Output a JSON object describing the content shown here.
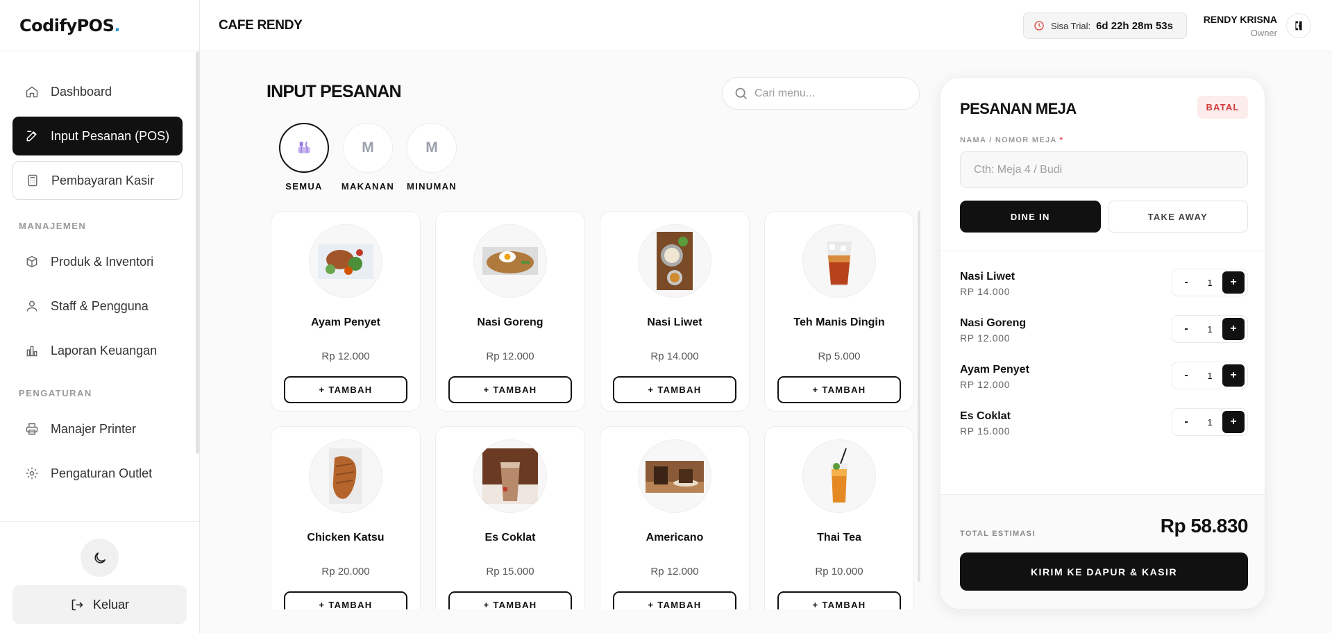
{
  "app": {
    "logo_text": "CodifyPOS",
    "logo_dot": "."
  },
  "sidebar": {
    "main_items": [
      {
        "label": "Dashboard",
        "icon": "home-icon"
      },
      {
        "label": "Input Pesanan (POS)",
        "icon": "edit-icon",
        "active": true
      },
      {
        "label": "Pembayaran Kasir",
        "icon": "calculator-icon"
      }
    ],
    "section_management": "MANAJEMEN",
    "management_items": [
      {
        "label": "Produk & Inventori",
        "icon": "box-icon"
      },
      {
        "label": "Staff & Pengguna",
        "icon": "users-icon"
      },
      {
        "label": "Laporan Keuangan",
        "icon": "bar-chart-icon"
      }
    ],
    "section_settings": "PENGATURAN",
    "settings_items": [
      {
        "label": "Manajer Printer",
        "icon": "printer-icon"
      },
      {
        "label": "Pengaturan Outlet",
        "icon": "gear-icon"
      }
    ],
    "logout_label": "Keluar"
  },
  "header": {
    "store_name": "CAFE RENDY",
    "trial_label": "Sisa Trial:",
    "trial_value": "6d 22h 28m 53s",
    "user_name": "RENDY KRISNA",
    "user_role": "Owner"
  },
  "main": {
    "title": "INPUT PESANAN",
    "search_placeholder": "Cari menu...",
    "categories": [
      {
        "label": "SEMUA",
        "initial": "",
        "active": true
      },
      {
        "label": "MAKANAN",
        "initial": "M"
      },
      {
        "label": "MINUMAN",
        "initial": "M"
      }
    ],
    "add_label": "+ TAMBAH",
    "products": [
      {
        "name": "Ayam Penyet",
        "price": "Rp 12.000",
        "image": "ayam-penyet"
      },
      {
        "name": "Nasi Goreng",
        "price": "Rp 12.000",
        "image": "nasi-goreng"
      },
      {
        "name": "Nasi Liwet",
        "price": "Rp 14.000",
        "image": "nasi-liwet"
      },
      {
        "name": "Teh Manis Dingin",
        "price": "Rp 5.000",
        "image": "teh-manis"
      },
      {
        "name": "Chicken Katsu",
        "price": "Rp 20.000",
        "image": "chicken-katsu"
      },
      {
        "name": "Es Coklat",
        "price": "Rp 15.000",
        "image": "es-coklat"
      },
      {
        "name": "Americano",
        "price": "Rp 12.000",
        "image": "americano"
      },
      {
        "name": "Thai Tea",
        "price": "Rp 10.000",
        "image": "thai-tea"
      }
    ]
  },
  "order": {
    "title": "PESANAN MEJA",
    "cancel_label": "BATAL",
    "field_label": "NAMA / NOMOR MEJA",
    "field_required": "*",
    "field_placeholder": "Cth: Meja 4 / Budi",
    "dine_in_label": "DINE IN",
    "take_away_label": "TAKE AWAY",
    "items": [
      {
        "name": "Nasi Liwet",
        "price": "RP 14.000",
        "qty": "1"
      },
      {
        "name": "Nasi Goreng",
        "price": "RP 12.000",
        "qty": "1"
      },
      {
        "name": "Ayam Penyet",
        "price": "RP 12.000",
        "qty": "1"
      },
      {
        "name": "Es Coklat",
        "price": "RP 15.000",
        "qty": "1"
      }
    ],
    "minus_label": "-",
    "plus_label": "+",
    "total_label": "TOTAL ESTIMASI",
    "total_value": "Rp 58.830",
    "submit_label": "KIRIM KE DAPUR & KASIR"
  },
  "colors": {
    "accent": "#111111",
    "danger": "#e0413f",
    "logo_dot": "#2e9bd6"
  }
}
